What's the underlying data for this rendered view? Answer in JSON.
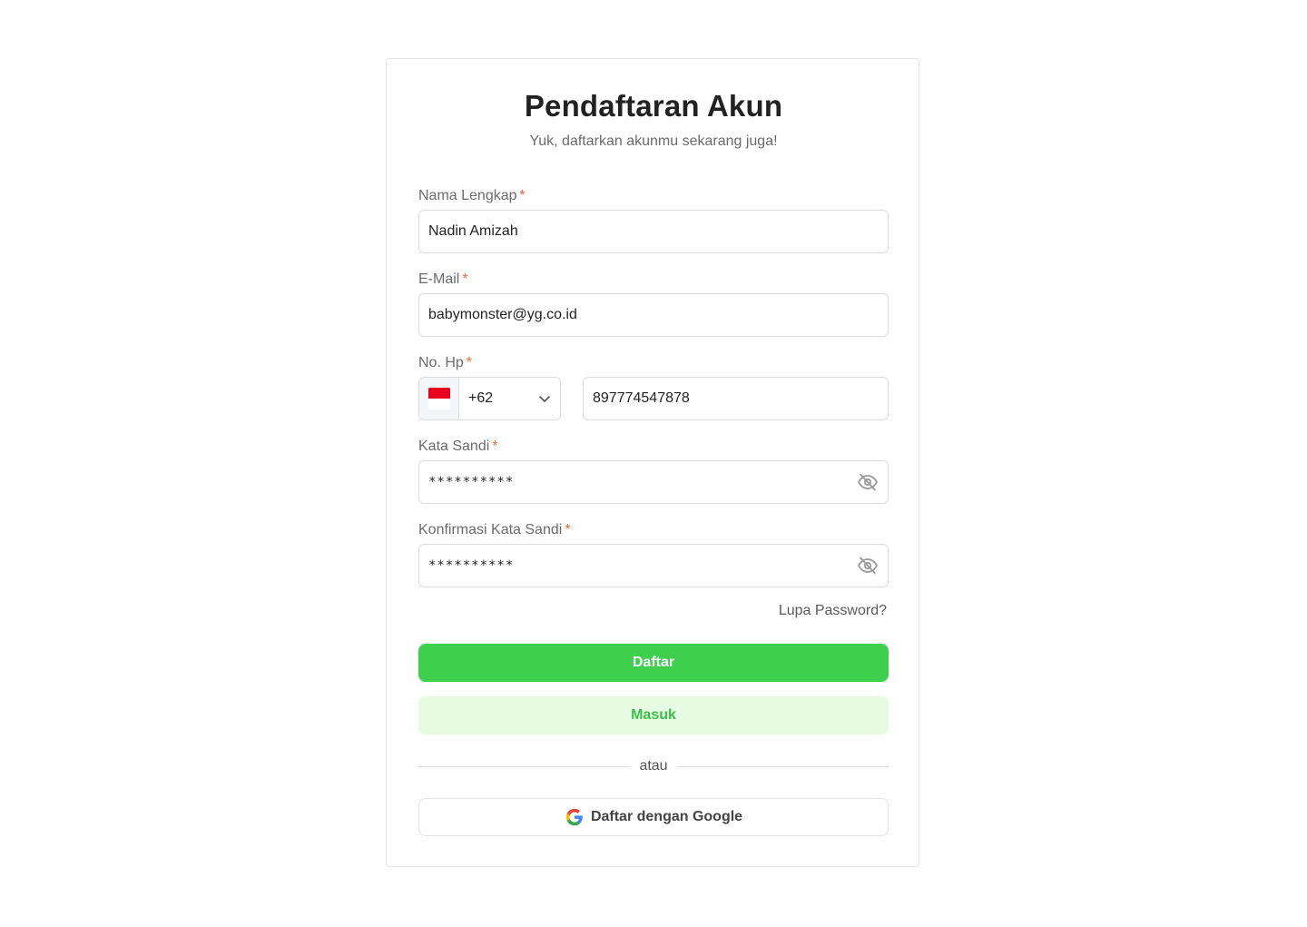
{
  "header": {
    "title": "Pendaftaran Akun",
    "subtitle": "Yuk, daftarkan akunmu sekarang juga!"
  },
  "form": {
    "name": {
      "label": "Nama Lengkap",
      "required_mark": "*",
      "value": "Nadin Amizah"
    },
    "email": {
      "label": "E-Mail",
      "required_mark": "*",
      "value": "babymonster@yg.co.id"
    },
    "phone": {
      "label": "No. Hp",
      "required_mark": "*",
      "country_flag_icon": "indonesia-flag-icon",
      "country_code": "+62",
      "value": "897774547878"
    },
    "password": {
      "label": "Kata Sandi",
      "required_mark": "*",
      "value": "**********",
      "toggle_icon": "eye-off-icon"
    },
    "confirm_password": {
      "label": "Konfirmasi Kata Sandi",
      "required_mark": "*",
      "value": "**********",
      "toggle_icon": "eye-off-icon"
    },
    "forgot_link": "Lupa Password?"
  },
  "actions": {
    "register_label": "Daftar",
    "login_label": "Masuk",
    "divider_text": "atau",
    "google_label": "Daftar dengan Google",
    "google_icon": "google-icon"
  },
  "colors": {
    "primary": "#3ecf4f",
    "primary_light": "#e6fbe2",
    "required": "#f26a3c",
    "flag_red": "#e8001c"
  }
}
